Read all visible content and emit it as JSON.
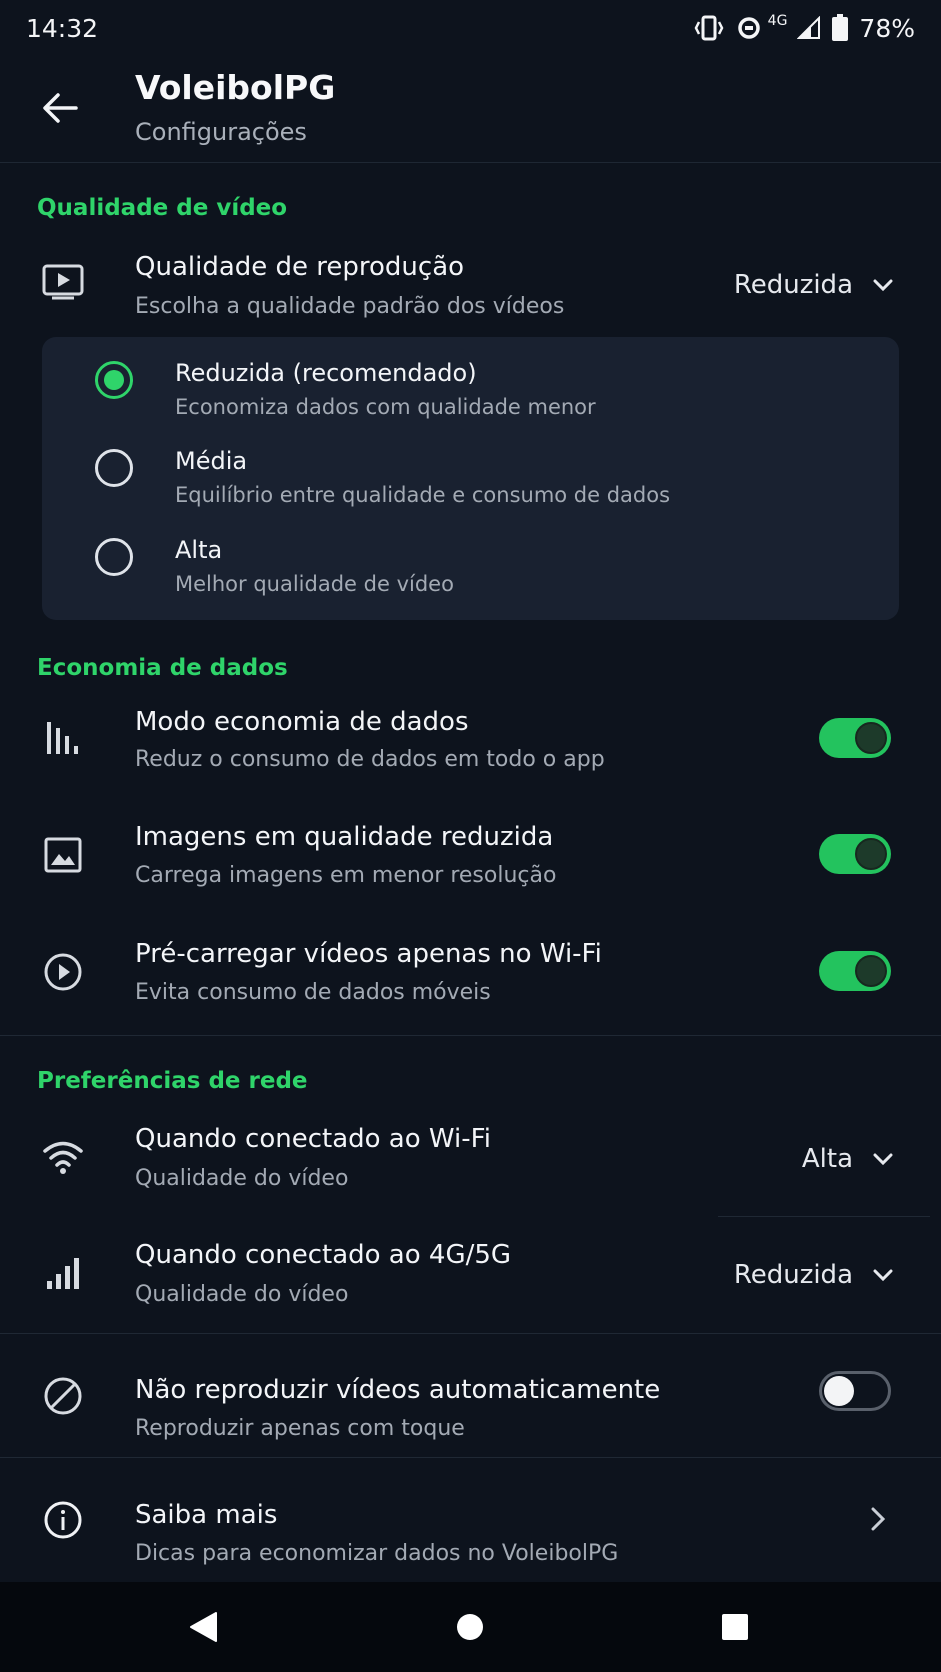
{
  "status": {
    "time": "14:32",
    "network": "4G",
    "battery": "78%"
  },
  "appbar": {
    "title": "VoleibolPG",
    "subtitle": "Configurações"
  },
  "video_quality": {
    "section_title": "Qualidade de vídeo",
    "playback": {
      "title": "Qualidade de reprodução",
      "subtitle": "Escolha a qualidade padrão dos vídeos",
      "value": "Reduzida"
    },
    "options": [
      {
        "label": "Reduzida (recomendado)",
        "description": "Economiza dados com qualidade menor",
        "selected": true
      },
      {
        "label": "Média",
        "description": "Equilíbrio entre qualidade e consumo de dados",
        "selected": false
      },
      {
        "label": "Alta",
        "description": "Melhor qualidade de vídeo",
        "selected": false
      }
    ]
  },
  "data_saving": {
    "section_title": "Economia de dados",
    "items": [
      {
        "title": "Modo economia de dados",
        "subtitle": "Reduz o consumo de dados em todo o app",
        "enabled": true,
        "icon": "bar-chart-icon"
      },
      {
        "title": "Imagens em qualidade reduzida",
        "subtitle": "Carrega imagens em menor resolução",
        "enabled": true,
        "icon": "image-icon"
      },
      {
        "title": "Pré-carregar vídeos apenas no Wi-Fi",
        "subtitle": "Evita consumo de dados móveis",
        "enabled": true,
        "icon": "play-circle-icon"
      }
    ]
  },
  "network": {
    "section_title": "Preferências de rede",
    "wifi": {
      "title": "Quando conectado ao Wi-Fi",
      "subtitle": "Qualidade do vídeo",
      "value": "Alta"
    },
    "mobile": {
      "title": "Quando conectado ao 4G/5G",
      "subtitle": "Qualidade do vídeo",
      "value": "Reduzida"
    },
    "autoplay": {
      "title": "Não reproduzir vídeos automaticamente",
      "subtitle": "Reproduzir apenas com toque",
      "enabled": false
    }
  },
  "learn_more": {
    "title": "Saiba mais",
    "subtitle": "Dicas para economizar dados no VoleibolPG"
  },
  "colors": {
    "accent": "#2fd46a",
    "background": "#0d131d",
    "card": "#192130"
  }
}
